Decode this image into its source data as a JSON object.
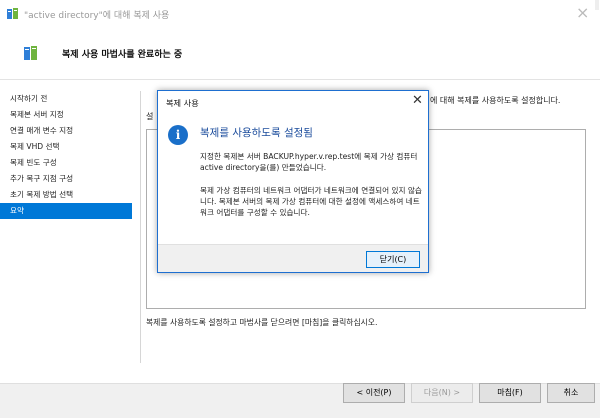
{
  "window": {
    "title": "\"active directory\"에 대해 복제 사용",
    "close_glyph": "×"
  },
  "header": {
    "title": "복제 사용 마법사를 완료하는 중"
  },
  "nav": {
    "items": [
      {
        "label": "시작하기 전"
      },
      {
        "label": "복제본 서버 지정"
      },
      {
        "label": "연결 매개 변수 지정"
      },
      {
        "label": "복제 VHD 선택"
      },
      {
        "label": "복제 빈도 구성"
      },
      {
        "label": "추가 복구 지점 구성"
      },
      {
        "label": "초기 복제 방법 선택"
      },
      {
        "label": "요약"
      }
    ],
    "selected_index": 7
  },
  "main": {
    "intro_suffix": "에 대해 복제를 사용하도록 설정합니다.",
    "stub": "설",
    "finish_hint": "복제를 사용하도록 설정하고 마법사를 닫으려면 [마침]을 클릭하십시오."
  },
  "footer": {
    "prev_label": "< 이전(P)",
    "next_label": "다음(N) >",
    "finish_label": "마침(F)",
    "cancel_label": "취소"
  },
  "dialog": {
    "title": "복제 사용",
    "close_glyph": "✕",
    "icon_glyph": "i",
    "heading": "복제를 사용하도록 설정됨",
    "message1": "지정한 복제본 서버 BACKUP.hyper.v.rep.test에 복제 가상 컴퓨터 active directory을(를) 만들었습니다.",
    "message2": "복제 가상 컴퓨터의 네트워크 어댑터가 네트워크에 연결되어 있지 않습니다. 복제본 서버의 복제 가상 컴퓨터에 대한 설정에 액세스하여 네트워크 어댑터를 구성할 수 있습니다.",
    "close_button_label": "닫기(C)"
  },
  "colors": {
    "accent": "#0078d7",
    "heading_blue": "#1b4c9c",
    "info_icon": "#1a6fc9"
  },
  "icons": {
    "window": "hyperv-vm-icon",
    "header": "hyperv-vm-icon",
    "dialog": "info-icon"
  }
}
